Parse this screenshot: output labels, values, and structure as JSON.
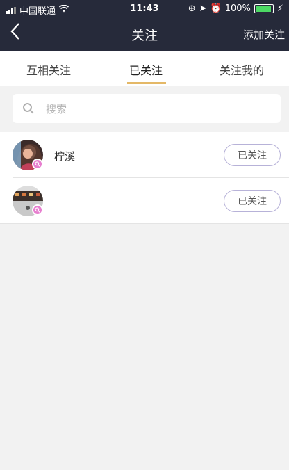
{
  "status_bar": {
    "carrier": "中国联通",
    "time": "11:43",
    "battery": "100%",
    "battery_color": "#4cd964"
  },
  "nav": {
    "back_icon": "chevron-left-icon",
    "title": "关注",
    "action_label": "添加关注"
  },
  "tabs": [
    {
      "label": "互相关注",
      "active": false
    },
    {
      "label": "已关注",
      "active": true
    },
    {
      "label": "关注我的",
      "active": false
    }
  ],
  "tab_accent_color": "#e4b867",
  "search": {
    "placeholder": "搜索",
    "value": ""
  },
  "following": [
    {
      "name": "柠溪",
      "button_label": "已关注",
      "badge_icon": "search-badge-icon"
    },
    {
      "name": "",
      "button_label": "已关注",
      "badge_icon": "search-badge-icon"
    }
  ],
  "colors": {
    "header_bg": "#262a3a",
    "badge": "#e77ecf",
    "button_border": "#b7b2d8"
  }
}
